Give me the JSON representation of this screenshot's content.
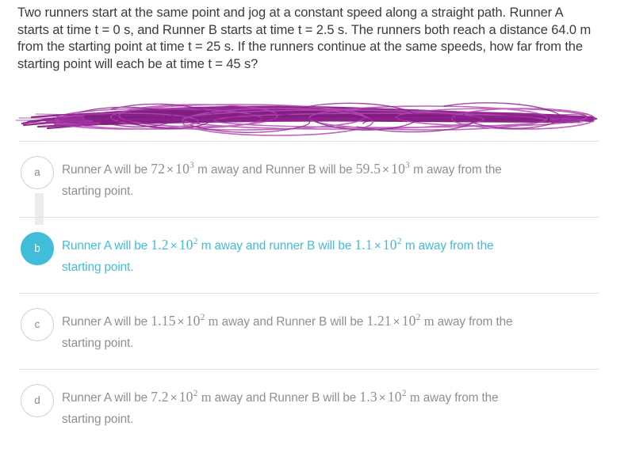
{
  "page": {
    "background_color": "#ffffff",
    "text_color": "#3b3b3b",
    "muted_text_color": "#8f8f8f",
    "accent_color": "#41bdda",
    "divider_color": "#e2e2e2",
    "scribble_color": "#8b1f8b",
    "scribble_color_light": "#b44ab4"
  },
  "question": {
    "stem": "Two runners start at the same point and jog at a constant speed along a straight path. Runner A starts at time t = 0 s, and Runner B starts at time t = 2.5 s. The runners both reach a distance 64.0 m from the starting point at time t = 25 s. If the runners continue at the same speeds, how far from the starting point will each be at time t = 45 s?"
  },
  "redaction": {
    "name": "scribbled-over-work",
    "description": "purple hand-drawn scribble covering an image/answer area",
    "placeholder_bar_color": "#ececec"
  },
  "answers": [
    {
      "letter": "a",
      "selected": false,
      "line1_pre": "Runner A will be ",
      "m1_coef": "72",
      "m1_times": "×",
      "m1_base": "10",
      "m1_exp": "3",
      "line1_mid_unit": "m",
      "line1_mid": " away and Runner B will be ",
      "m2_coef": "59.5",
      "m2_times": "×",
      "m2_base": "10",
      "m2_exp": "3",
      "line1_end_unit": "m",
      "line1_end": " away from the",
      "line2": "starting point.",
      "unit_style": "sans"
    },
    {
      "letter": "b",
      "selected": true,
      "line1_pre": "Runner A will be ",
      "m1_coef": "1.2",
      "m1_times": "×",
      "m1_base": "10",
      "m1_exp": "2",
      "line1_mid_unit": "m",
      "line1_mid": " away and runner B will be ",
      "m2_coef": "1.1",
      "m2_times": "×",
      "m2_base": "10",
      "m2_exp": "2",
      "line1_end_unit": "m",
      "line1_end": " away from the",
      "line2": "starting point.",
      "unit_style": "sans"
    },
    {
      "letter": "c",
      "selected": false,
      "line1_pre": "Runner A will be ",
      "m1_coef": "1.15",
      "m1_times": "×",
      "m1_base": "10",
      "m1_exp": "2",
      "line1_mid_unit": "m",
      "line1_mid": " away and Runner B will be ",
      "m2_coef": "1.21",
      "m2_times": "×",
      "m2_base": "10",
      "m2_exp": "2",
      "line1_end_unit": "m",
      "line1_end": " away from the",
      "line2": "starting point.",
      "unit_style": "serif"
    },
    {
      "letter": "d",
      "selected": false,
      "line1_pre": "Runner A will be ",
      "m1_coef": "7.2",
      "m1_times": "×",
      "m1_base": "10",
      "m1_exp": "2",
      "line1_mid_unit": "m",
      "line1_mid": " away and Runner B will be ",
      "m2_coef": "1.3",
      "m2_times": "×",
      "m2_base": "10",
      "m2_exp": "2",
      "line1_end_unit": "m",
      "line1_end": " away from the",
      "line2": "starting point.",
      "unit_style": "serif"
    }
  ]
}
